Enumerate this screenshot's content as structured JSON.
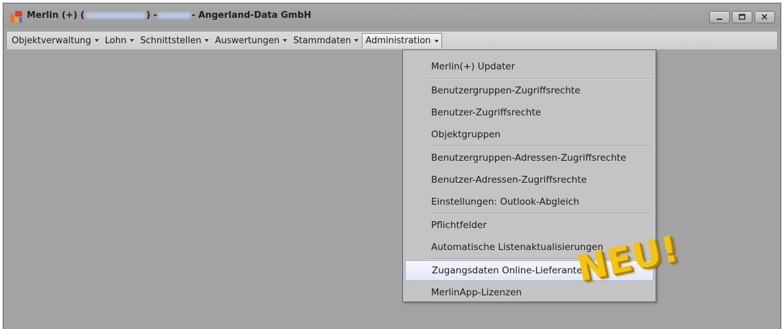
{
  "window": {
    "title_prefix": "Merlin (+) (",
    "title_mid": ") - ",
    "title_suffix": " - Angerland-Data GmbH"
  },
  "menubar": {
    "items": [
      {
        "label": "Objektverwaltung"
      },
      {
        "label": "Lohn"
      },
      {
        "label": "Schnittstellen"
      },
      {
        "label": "Auswertungen"
      },
      {
        "label": "Stammdaten"
      },
      {
        "label": "Administration"
      }
    ]
  },
  "dropdown": {
    "items": [
      {
        "label": "Merlin(+) Updater"
      },
      {
        "label": "Benutzergruppen-Zugriffsrechte"
      },
      {
        "label": "Benutzer-Zugriffsrechte"
      },
      {
        "label": "Objektgruppen"
      },
      {
        "label": "Benutzergruppen-Adressen-Zugriffsrechte"
      },
      {
        "label": "Benutzer-Adressen-Zugriffsrechte"
      },
      {
        "label": "Einstellungen: Outlook-Abgleich"
      },
      {
        "label": "Pflichtfelder"
      },
      {
        "label": "Automatische Listenaktualisierungen"
      },
      {
        "label": "Zugangsdaten Online-Lieferanten"
      },
      {
        "label": "MerlinApp-Lizenzen"
      }
    ],
    "highlighted": "Zugangsdaten Online-Lieferanten"
  },
  "overlay": {
    "badge": "NEU!",
    "badge_color": "#f5c40d"
  },
  "icons": [
    "app-logo-icon",
    "minimize-icon",
    "maximize-icon",
    "close-icon",
    "chevron-down-icon"
  ]
}
